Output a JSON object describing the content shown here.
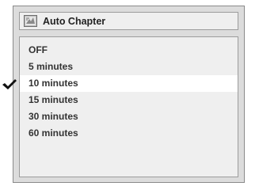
{
  "menu": {
    "title": "Auto Chapter",
    "icon": "auto-chapter-icon",
    "selected_index": 2,
    "items": [
      {
        "label": "OFF"
      },
      {
        "label": "5 minutes"
      },
      {
        "label": "10 minutes"
      },
      {
        "label": "15 minutes"
      },
      {
        "label": "30 minutes"
      },
      {
        "label": "60 minutes"
      }
    ]
  },
  "colors": {
    "panel": "#dcdcdc",
    "highlight": "#ffffff",
    "text": "#333333"
  }
}
